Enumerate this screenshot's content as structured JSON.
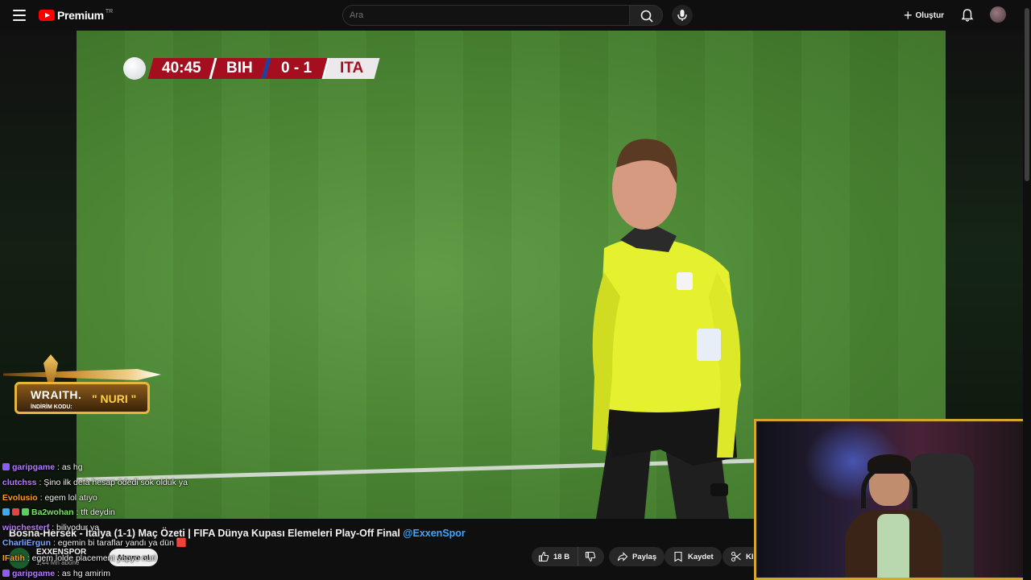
{
  "header": {
    "logo_text": "Premium",
    "logo_region": "TR",
    "search_placeholder": "Ara",
    "create_label": "Oluştur"
  },
  "scoreboard": {
    "time": "40:45",
    "home": "BIH",
    "score": "0 - 1",
    "away": "ITA"
  },
  "sponsor": {
    "brand": "WRAITH.",
    "code_label": "İNDİRİM KODU:",
    "code": "\" NURI \""
  },
  "chat": [
    {
      "user": "garipgame",
      "message": ": as hg",
      "color": "#b57bff",
      "badge": "#8b5cf6"
    },
    {
      "user": "clutchss",
      "message": ": Şino ilk defa hesap ödedi sok olduk ya",
      "color": "#b57bff",
      "badge": ""
    },
    {
      "user": "Evolusio",
      "message": ": egem lol atıyo",
      "color": "#ff9f1a",
      "badge": ""
    },
    {
      "user": "Ba2wohan",
      "message": ": tft deydin",
      "color": "#7fe36b",
      "badge": "#3fa9f5"
    },
    {
      "user": "winchesterf",
      "message": ": biliyodur ya",
      "color": "#b57bff",
      "badge": ""
    },
    {
      "user": "CharliErgun",
      "message": ": egemin bi taraflar yandı ya dün 🟥",
      "color": "#7aa7ff",
      "badge": ""
    },
    {
      "user": "IFatih",
      "message": ": egem lolde placement yapyo nuri",
      "color": "#ff9f1a",
      "badge": ""
    },
    {
      "user": "garipgame",
      "message": ": as hg amirim",
      "color": "#b57bff",
      "badge": "#8b5cf6"
    }
  ],
  "video": {
    "title": "Bosna-Hersek - İtalya (1-1) Maç Özeti | FIFA Dünya Kupası Elemeleri Play-Off Final",
    "mention": "@ExxenSpor",
    "channel": "EXXENSPOR",
    "subscribers": "1,44 Mn abone",
    "subscribe_label": "Abone ol",
    "likes": "18 B",
    "share_label": "Paylaş",
    "save_label": "Kaydet",
    "clip_label": "Klip"
  },
  "colors": {
    "accent_red": "#ff0000",
    "scoreboard_red": "#a50e1e",
    "webcam_border": "#d4a72c",
    "link_blue": "#3ea6ff"
  },
  "icons": [
    "menu-icon",
    "youtube-logo-icon",
    "search-icon",
    "mic-icon",
    "plus-icon",
    "bell-icon",
    "avatar",
    "like-icon",
    "dislike-icon",
    "share-icon",
    "save-icon",
    "clip-icon"
  ]
}
